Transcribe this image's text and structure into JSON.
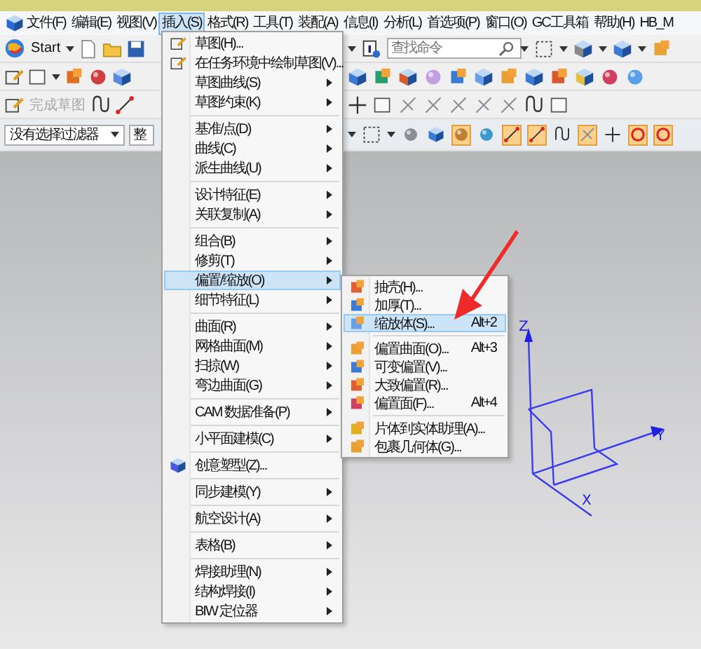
{
  "menu_bar": [
    {
      "label": "文件(F)",
      "selected": false
    },
    {
      "label": "编辑(E)",
      "selected": false
    },
    {
      "label": "视图(V)",
      "selected": false
    },
    {
      "label": "插入(S)",
      "selected": true
    },
    {
      "label": "格式(R)",
      "selected": false
    },
    {
      "label": "工具(T)",
      "selected": false
    },
    {
      "label": "装配(A)",
      "selected": false
    },
    {
      "label": "信息(I)",
      "selected": false
    },
    {
      "label": "分析(L)",
      "selected": false
    },
    {
      "label": "首选项(P)",
      "selected": false
    },
    {
      "label": "窗口(O)",
      "selected": false
    },
    {
      "label": "GC工具箱",
      "selected": false
    },
    {
      "label": "帮助(H)",
      "selected": false
    },
    {
      "label": "HB_M",
      "selected": false
    }
  ],
  "toolbar": {
    "start_label": "Start",
    "search": {
      "placeholder": "查找命令"
    },
    "finish_sketch": {
      "label": "完成草图",
      "disabled": true
    }
  },
  "selection_bar": {
    "filter": {
      "value": "没有选择过滤器"
    },
    "scope": {
      "value": "整"
    },
    "snap_buttons": [
      {
        "on": false
      },
      {
        "on": false
      },
      {
        "on": true
      },
      {
        "on": false
      },
      {
        "on": true
      },
      {
        "on": true
      },
      {
        "on": false
      },
      {
        "on": true
      },
      {
        "on": false
      },
      {
        "on": true
      },
      {
        "on": true
      }
    ]
  },
  "insert_menu": {
    "items": [
      {
        "kind": "item",
        "label": "草图(H)...",
        "submenu": false,
        "selected": false
      },
      {
        "kind": "item",
        "label": "在任务环境中绘制草图(V)...",
        "submenu": false,
        "selected": false
      },
      {
        "kind": "item",
        "label": "草图曲线(S)",
        "submenu": true,
        "selected": false
      },
      {
        "kind": "item",
        "label": "草图约束(K)",
        "submenu": true,
        "selected": false
      },
      {
        "kind": "separator"
      },
      {
        "kind": "item",
        "label": "基准/点(D)",
        "submenu": true,
        "selected": false
      },
      {
        "kind": "item",
        "label": "曲线(C)",
        "submenu": true,
        "selected": false
      },
      {
        "kind": "item",
        "label": "派生曲线(U)",
        "submenu": true,
        "selected": false
      },
      {
        "kind": "separator"
      },
      {
        "kind": "item",
        "label": "设计特征(E)",
        "submenu": true,
        "selected": false
      },
      {
        "kind": "item",
        "label": "关联复制(A)",
        "submenu": true,
        "selected": false
      },
      {
        "kind": "separator"
      },
      {
        "kind": "item",
        "label": "组合(B)",
        "submenu": true,
        "selected": false
      },
      {
        "kind": "item",
        "label": "修剪(T)",
        "submenu": true,
        "selected": false
      },
      {
        "kind": "item",
        "label": "偏置/缩放(O)",
        "submenu": true,
        "selected": true
      },
      {
        "kind": "item",
        "label": "细节特征(L)",
        "submenu": true,
        "selected": false
      },
      {
        "kind": "separator"
      },
      {
        "kind": "item",
        "label": "曲面(R)",
        "submenu": true,
        "selected": false
      },
      {
        "kind": "item",
        "label": "网格曲面(M)",
        "submenu": true,
        "selected": false
      },
      {
        "kind": "item",
        "label": "扫掠(W)",
        "submenu": true,
        "selected": false
      },
      {
        "kind": "item",
        "label": "弯边曲面(G)",
        "submenu": true,
        "selected": false
      },
      {
        "kind": "separator"
      },
      {
        "kind": "item",
        "label": "CAM 数据准备(P)",
        "submenu": true,
        "selected": false
      },
      {
        "kind": "separator"
      },
      {
        "kind": "item",
        "label": "小平面建模(C)",
        "submenu": true,
        "selected": false
      },
      {
        "kind": "separator"
      },
      {
        "kind": "item",
        "label": "创意塑型(Z)...",
        "submenu": false,
        "selected": false
      },
      {
        "kind": "separator"
      },
      {
        "kind": "item",
        "label": "同步建模(Y)",
        "submenu": true,
        "selected": false
      },
      {
        "kind": "separator"
      },
      {
        "kind": "item",
        "label": "航空设计(A)",
        "submenu": true,
        "selected": false
      },
      {
        "kind": "separator"
      },
      {
        "kind": "item",
        "label": "表格(B)",
        "submenu": true,
        "selected": false
      },
      {
        "kind": "separator"
      },
      {
        "kind": "item",
        "label": "焊接助理(N)",
        "submenu": true,
        "selected": false
      },
      {
        "kind": "item",
        "label": "结构焊接(I)",
        "submenu": true,
        "selected": false
      },
      {
        "kind": "item",
        "label": "BIW 定位器",
        "submenu": true,
        "selected": false
      }
    ]
  },
  "offset_scale_submenu": {
    "items": [
      {
        "kind": "item",
        "label": "抽壳(H)...",
        "selected": false
      },
      {
        "kind": "item",
        "label": "加厚(T)...",
        "selected": false
      },
      {
        "kind": "item",
        "label": "缩放体(S)...",
        "shortcut": "Alt+2",
        "selected": true
      },
      {
        "kind": "separator"
      },
      {
        "kind": "item",
        "label": "偏置曲面(O)...",
        "shortcut": "Alt+3",
        "selected": false
      },
      {
        "kind": "item",
        "label": "可变偏置(V)...",
        "selected": false
      },
      {
        "kind": "item",
        "label": "大致偏置(R)...",
        "selected": false
      },
      {
        "kind": "item",
        "label": "偏置面(F)...",
        "shortcut": "Alt+4",
        "selected": false
      },
      {
        "kind": "separator"
      },
      {
        "kind": "item",
        "label": "片体到实体助理(A)...",
        "selected": false
      },
      {
        "kind": "item",
        "label": "包裹几何体(G)...",
        "selected": false
      }
    ]
  },
  "viewport": {
    "axis_labels": {
      "z": "Z",
      "y": "Y",
      "x": "X"
    }
  }
}
